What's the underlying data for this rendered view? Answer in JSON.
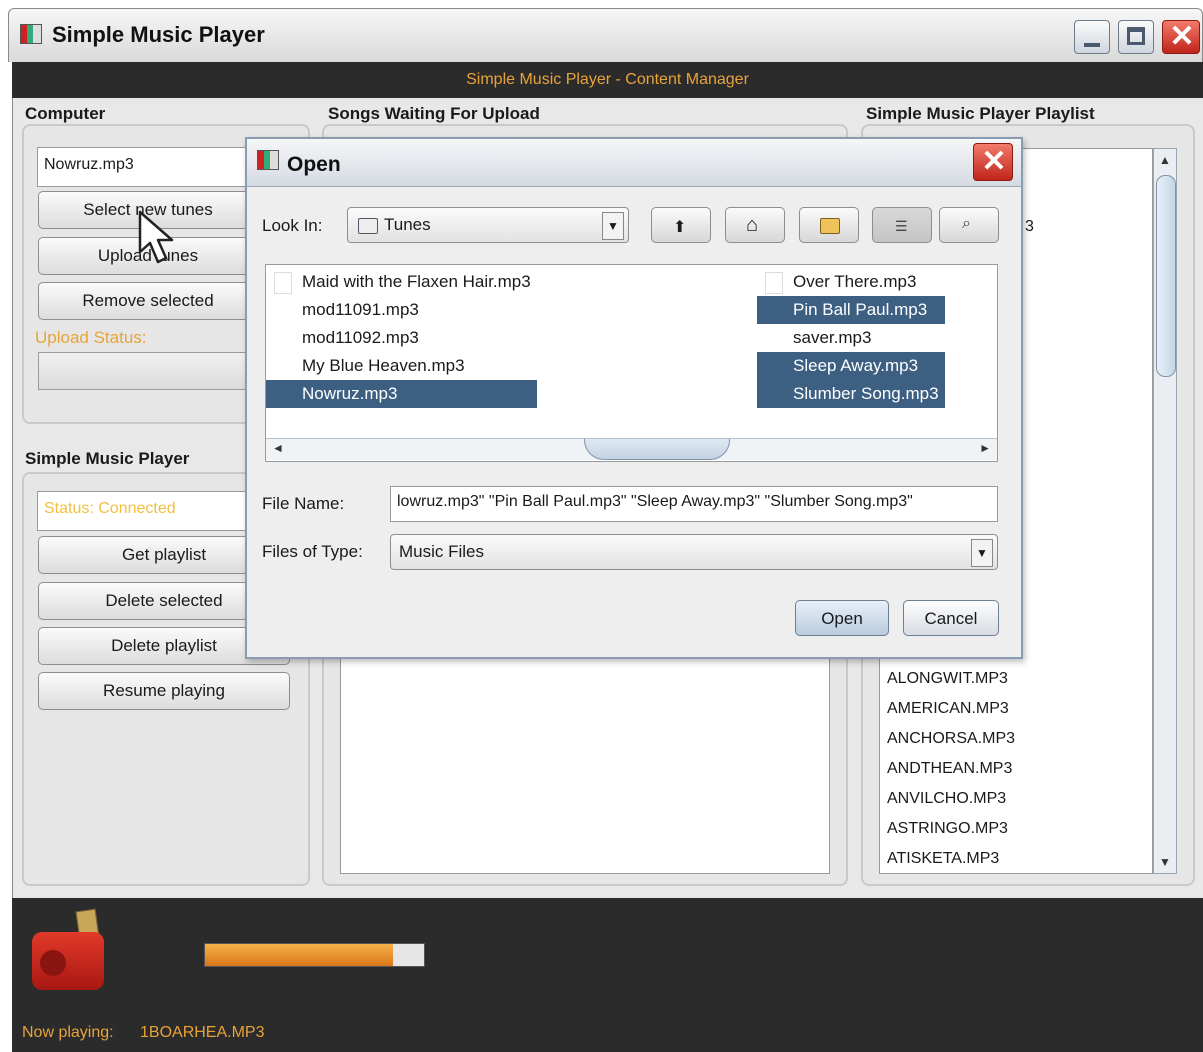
{
  "window": {
    "title": "Simple Music Player",
    "header": "Simple Music Player - Content Manager"
  },
  "computer": {
    "title": "Computer",
    "selected_file": "Nowruz.mp3",
    "select_button": "Select new tunes",
    "upload_button": "Upload tunes",
    "remove_button": "Remove selected",
    "upload_status_label": "Upload Status:"
  },
  "waiting": {
    "title": "Songs Waiting For Upload"
  },
  "player": {
    "title": "Simple Music Player",
    "status": "Status: Connected",
    "get_playlist": "Get playlist",
    "delete_selected": "Delete selected",
    "delete_playlist": "Delete playlist",
    "resume_playing": "Resume playing"
  },
  "playlist": {
    "title": "Simple Music Player Playlist",
    "items": [
      "ALONGWIT.MP3",
      "AMERICAN.MP3",
      "ANCHORSA.MP3",
      "ANDTHEAN.MP3",
      "ANVILCHO.MP3",
      "ASTRINGO.MP3",
      "ATISKETA.MP3"
    ]
  },
  "progress": {
    "fraction": 0.86
  },
  "now_playing": {
    "label": "Now playing:",
    "track": "1BOARHEA.MP3"
  },
  "dialog": {
    "title": "Open",
    "look_in_label": "Look In:",
    "look_in_value": "Tunes",
    "file_name_label": "File Name:",
    "file_name_value": "lowruz.mp3\" \"Pin Ball Paul.mp3\" \"Sleep Away.mp3\" \"Slumber Song.mp3\"",
    "files_of_type_label": "Files of Type:",
    "files_of_type_value": "Music Files",
    "open_button": "Open",
    "cancel_button": "Cancel",
    "files_col1": [
      {
        "name": "Maid with the Flaxen Hair.mp3",
        "selected": false
      },
      {
        "name": "mod11091.mp3",
        "selected": false
      },
      {
        "name": "mod11092.mp3",
        "selected": false
      },
      {
        "name": "My Blue Heaven.mp3",
        "selected": false
      },
      {
        "name": "Nowruz.mp3",
        "selected": true
      }
    ],
    "files_col2": [
      {
        "name": "Over There.mp3",
        "selected": false
      },
      {
        "name": "Pin Ball Paul.mp3",
        "selected": true
      },
      {
        "name": "saver.mp3",
        "selected": false
      },
      {
        "name": "Sleep Away.mp3",
        "selected": true
      },
      {
        "name": "Slumber Song.mp3",
        "selected": true
      }
    ]
  },
  "colors": {
    "accent": "#e8a33a",
    "selection": "#3c5f82",
    "dark_bar": "#2b2b2b"
  }
}
